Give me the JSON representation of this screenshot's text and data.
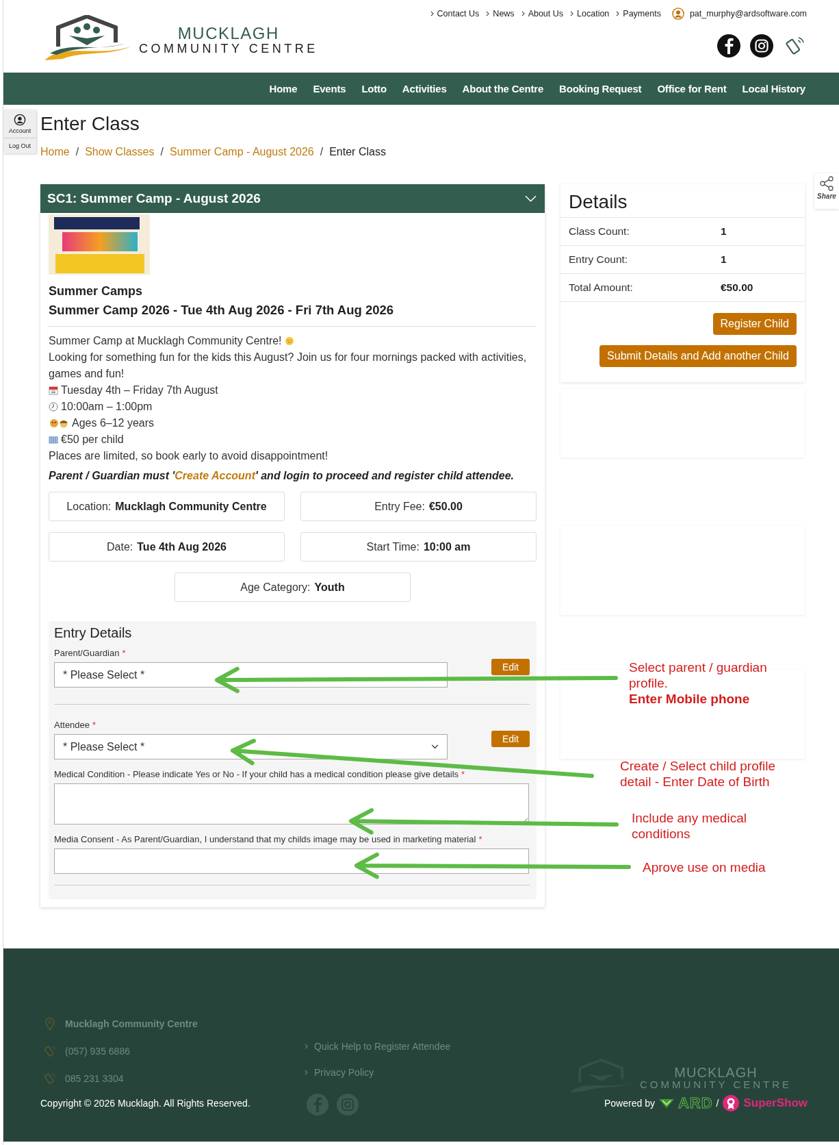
{
  "top_links": [
    {
      "label": "Contact Us"
    },
    {
      "label": "News"
    },
    {
      "label": "About Us"
    },
    {
      "label": "Location"
    },
    {
      "label": "Payments"
    }
  ],
  "user_email": "pat_murphy@ardsoftware.com",
  "logo": {
    "name": "MUCKLAGH",
    "subtitle": "COMMUNITY CENTRE"
  },
  "nav": [
    {
      "label": "Home"
    },
    {
      "label": "Events"
    },
    {
      "label": "Lotto"
    },
    {
      "label": "Activities"
    },
    {
      "label": "About the Centre"
    },
    {
      "label": "Booking Request"
    },
    {
      "label": "Office for Rent"
    },
    {
      "label": "Local History"
    }
  ],
  "account_bar": {
    "account": "Account",
    "logout": "Log Out"
  },
  "page_title": "Enter Class",
  "breadcrumb_separator": "/",
  "breadcrumb": [
    {
      "label": "Home",
      "link": true
    },
    {
      "label": "Show Classes",
      "link": true
    },
    {
      "label": "Summer Camp - August 2026",
      "link": true
    },
    {
      "label": "Enter Class",
      "link": false
    }
  ],
  "class_card": {
    "header": "SC1: Summer Camp - August 2026",
    "category": "Summer Camps",
    "subtitle": "Summer Camp 2026 - Tue 4th Aug 2026 - Fri 7th Aug 2026",
    "description": [
      {
        "kind": "sun",
        "text": "Summer Camp at Mucklagh Community Centre!"
      },
      {
        "kind": "plain",
        "text": "Looking for something fun for the kids this August? Join us for four mornings packed with activities, games and fun!"
      },
      {
        "kind": "calendar",
        "text": "Tuesday 4th – Friday 7th August"
      },
      {
        "kind": "clock",
        "text": "10:00am – 1:00pm"
      },
      {
        "kind": "kids",
        "text": "Ages 6–12 years"
      },
      {
        "kind": "money",
        "text": "€50 per child"
      },
      {
        "kind": "plain",
        "text": "Places are limited, so book early to avoid disappointment!"
      }
    ],
    "notice": {
      "before": "Parent / Guardian must '",
      "link": "Create Account",
      "after": "' and login to proceed and register child attendee."
    },
    "info_boxes": [
      {
        "label": "Location:",
        "value": "Mucklagh Community Centre"
      },
      {
        "label": "Entry Fee:",
        "value": "€50.00"
      },
      {
        "label": "Date:",
        "value": "Tue 4th Aug 2026"
      },
      {
        "label": "Start Time:",
        "value": "10:00 am"
      },
      {
        "label": "Age Category:",
        "value": "Youth"
      }
    ]
  },
  "entry_details": {
    "title": "Entry Details",
    "fields": [
      {
        "kind": "select",
        "label": "Parent/Guardian",
        "required_mark": "*",
        "value": "* Please Select *",
        "dropdown_arrow": false,
        "edit": "Edit"
      },
      {
        "kind": "select",
        "label": "Attendee",
        "required_mark": "*",
        "value": "* Please Select *",
        "dropdown_arrow": true,
        "edit": "Edit"
      },
      {
        "kind": "textarea",
        "label": "Medical Condition - Please indicate Yes or No - If your child has a medical condition please give details",
        "required_mark": "*"
      },
      {
        "kind": "input",
        "label": "Media Consent - As Parent/Guardian, I understand that my childs image may be used in marketing material",
        "required_mark": "*"
      }
    ]
  },
  "details": {
    "title": "Details",
    "rows": [
      {
        "label": "Class Count:",
        "value": "1"
      },
      {
        "label": "Entry Count:",
        "value": "1"
      },
      {
        "label": "Total Amount:",
        "value": "€50.00"
      }
    ],
    "buttons": [
      "Register Child",
      "Submit Details and Add another Child"
    ]
  },
  "share": {
    "label": "Share"
  },
  "annotations": [
    {
      "lines": [
        {
          "text": "Select parent / guardian",
          "bold": false
        },
        {
          "text": "profile.",
          "bold": false
        },
        {
          "text": "Enter Mobile phone",
          "bold": true
        }
      ]
    },
    {
      "lines": [
        {
          "text": "Create / Select child profile",
          "bold": false
        },
        {
          "text": "detail - Enter Date of Birth",
          "bold": false
        }
      ]
    },
    {
      "lines": [
        {
          "text": "Include any medical",
          "bold": false
        },
        {
          "text": "conditions",
          "bold": false
        }
      ]
    },
    {
      "lines": [
        {
          "text": "Aprove use on media",
          "bold": false
        }
      ]
    }
  ],
  "footer": {
    "contacts": [
      {
        "kind": "pin",
        "text": "Mucklagh Community Centre"
      },
      {
        "kind": "phone",
        "text": "(057) 935 6886"
      },
      {
        "kind": "phone",
        "text": "085 231 3304"
      }
    ],
    "links": [
      {
        "label": "Quick Help to Register Attendee"
      },
      {
        "label": "Privacy Policy"
      }
    ],
    "logo": {
      "name": "MUCKLAGH",
      "subtitle": "COMMUNITY CENTRE"
    },
    "copyright": "Copyright © 2026 Mucklagh. All Rights Reserved.",
    "powered_by": "Powered by",
    "ard": "ARD",
    "separator": "/",
    "supershow": "SuperShow"
  }
}
